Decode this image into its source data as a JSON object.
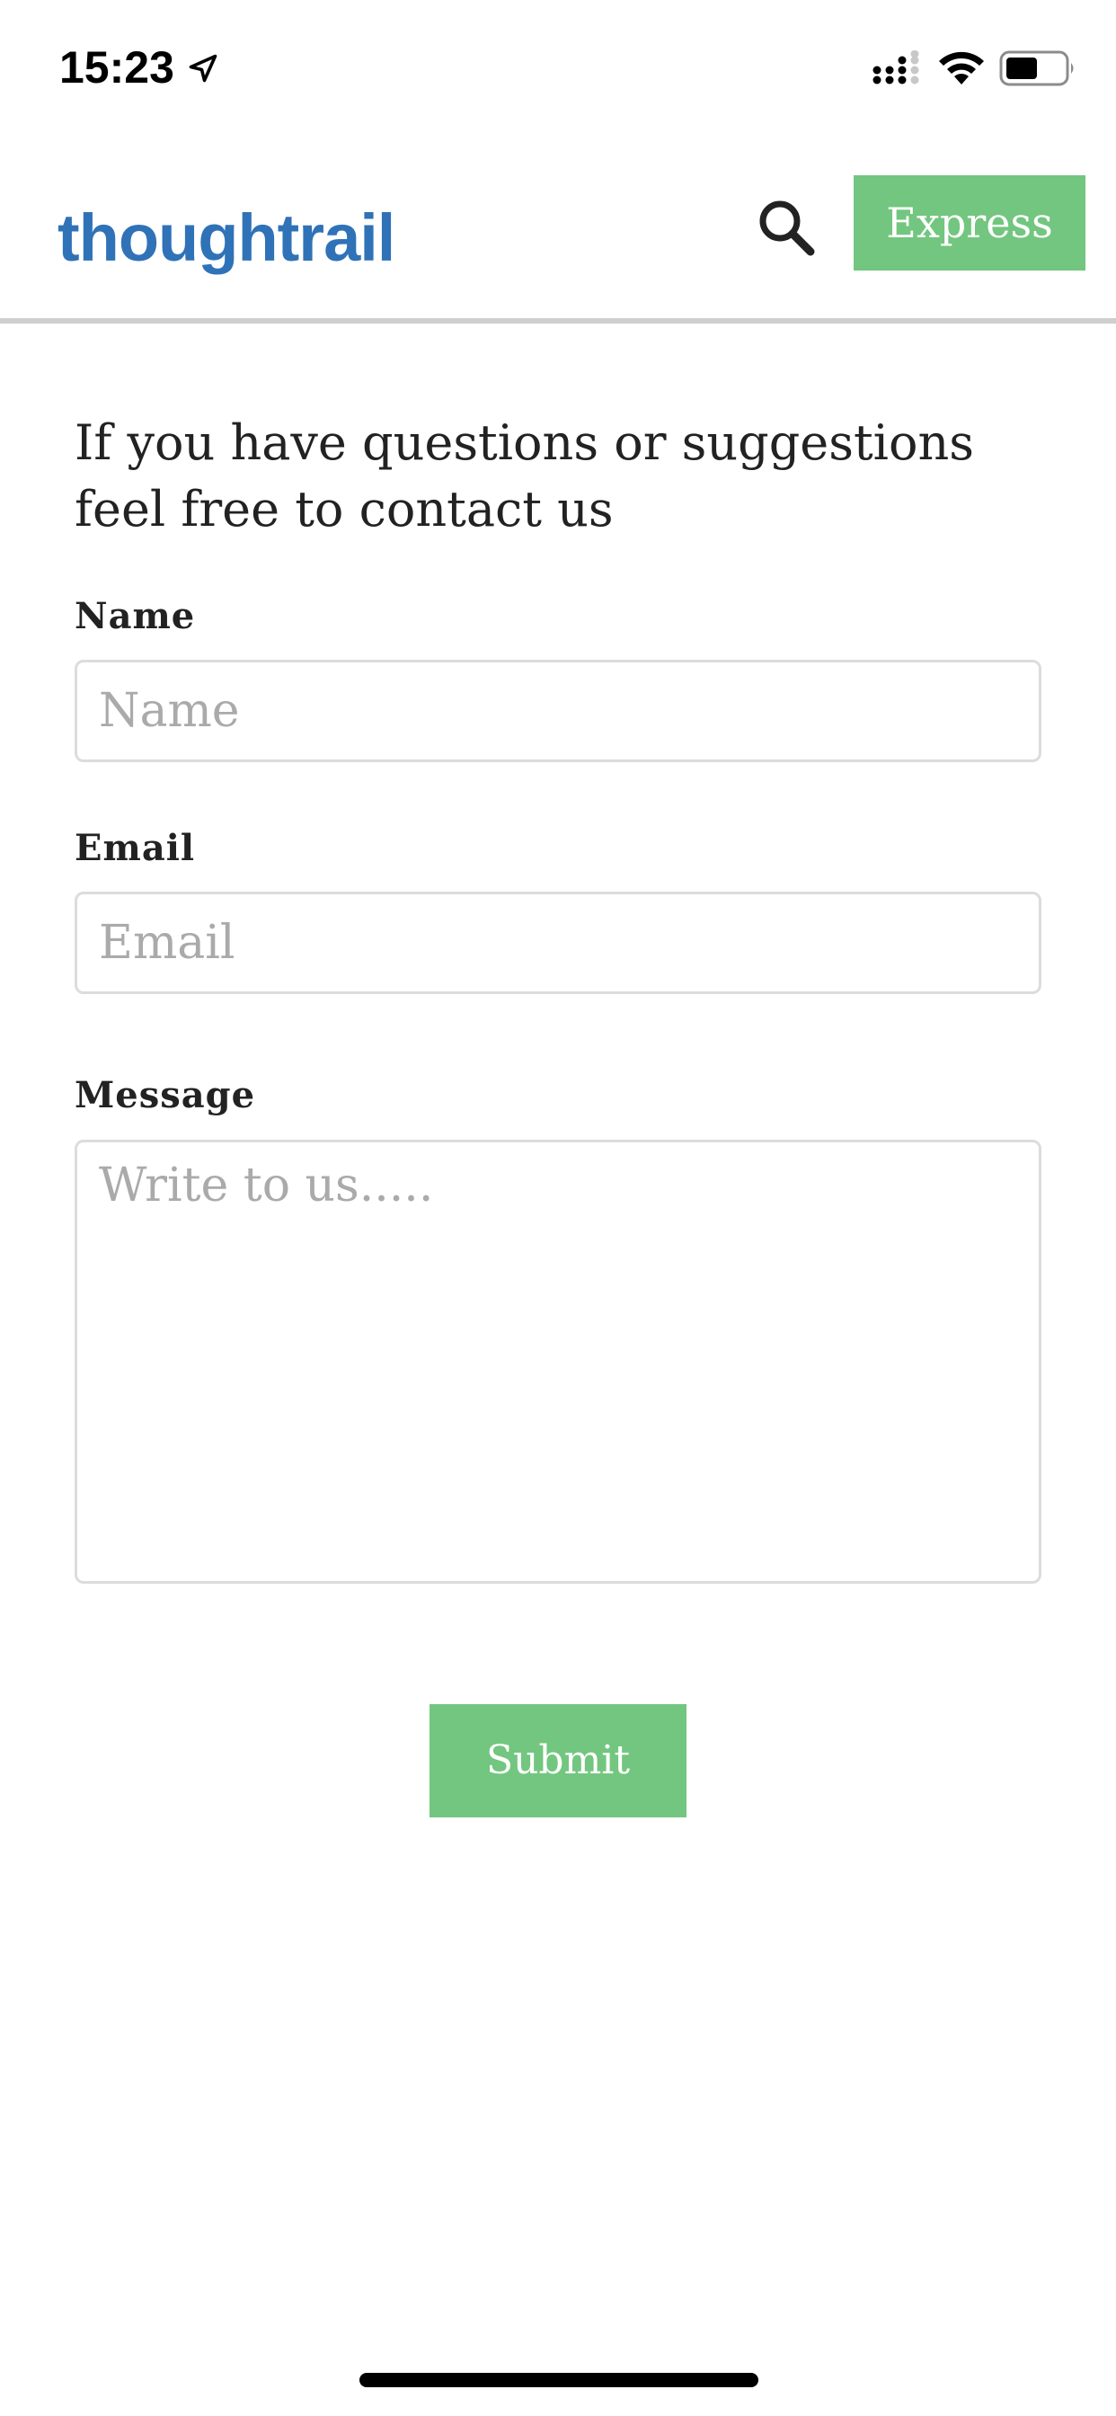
{
  "status_bar": {
    "time": "15:23",
    "icons": [
      "location-arrow-icon",
      "cellular-signal-icon",
      "wifi-icon",
      "battery-icon"
    ]
  },
  "header": {
    "brand": "thoughtrail",
    "brand_color": "#3072b7",
    "search_icon": "search-icon",
    "express_label": "Express",
    "accent_color": "#73c67f"
  },
  "form": {
    "intro": "If you have questions or suggestions feel free to contact us",
    "name": {
      "label": "Name",
      "placeholder": "Name",
      "value": ""
    },
    "email": {
      "label": "Email",
      "placeholder": "Email",
      "value": ""
    },
    "message": {
      "label": "Message",
      "placeholder": "Write to us.....",
      "value": ""
    },
    "submit_label": "Submit"
  }
}
